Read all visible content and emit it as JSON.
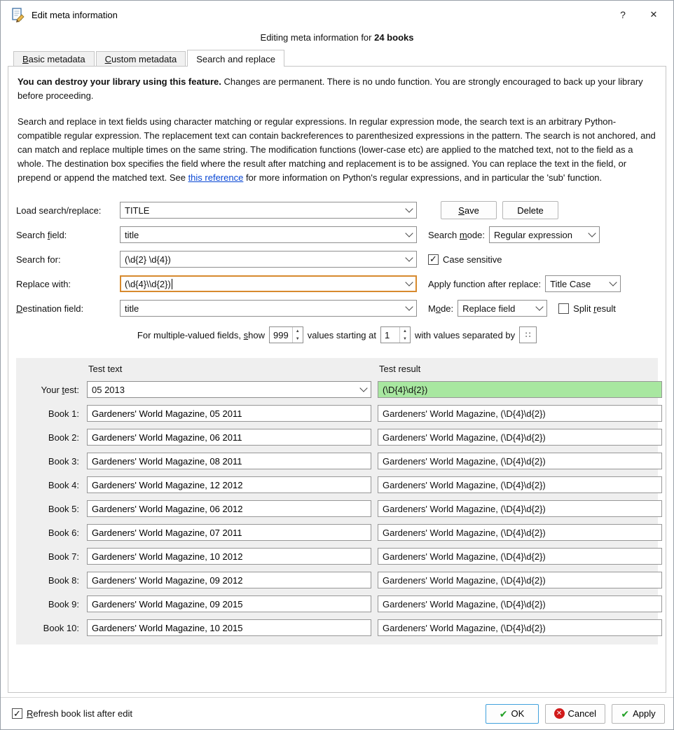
{
  "window": {
    "title": "Edit meta information",
    "help_label": "?",
    "close_label": "✕"
  },
  "header": {
    "caption_prefix": "Editing meta information for ",
    "caption_bold": "24 books"
  },
  "tabs": [
    {
      "label": "&Basic metadata"
    },
    {
      "label": "&Custom metadata"
    },
    {
      "label": "Search and replace"
    }
  ],
  "intro": {
    "warning_bold": "You can destroy your library using this feature.",
    "warning_rest": " Changes are permanent. There is no undo function. You are strongly encouraged to back up your library before proceeding.",
    "description_before_link": "Search and replace in text fields using character matching or regular expressions. In regular expression mode, the search text is an arbitrary Python-compatible regular expression. The replacement text can contain backreferences to parenthesized expressions in the pattern. The search is not anchored, and can match and replace multiple times on the same string. The modification functions (lower-case etc) are applied to the matched text, not to the field as a whole. The destination box specifies the field where the result after matching and replacement is to be assigned. You can replace the text in the field, or prepend or append the matched text. See ",
    "link_text": "this reference",
    "description_after_link": " for more information on Python's regular expressions, and in particular the 'sub' function."
  },
  "form": {
    "load_label": "Load search/replace:",
    "load_value": "TITLE",
    "save_button": "&Save",
    "delete_button": "Delete",
    "search_field_label": "Search &field:",
    "search_field_value": "title",
    "search_mode_label": "Search &mode:",
    "search_mode_value": "Regular expression",
    "search_for_label": "Search for:",
    "search_for_value": "(\\d{2} \\d{4})",
    "case_sensitive_label": "Case sensitive",
    "replace_with_label": "Replace with:",
    "replace_with_value": "(\\d{4}\\\\d{2})",
    "apply_function_label": "Apply function after replace:",
    "apply_function_value": "Title Case",
    "destination_label": "&Destination field:",
    "destination_value": "title",
    "mode_label": "M&ode:",
    "mode_value": "Replace field",
    "split_result_label": "Split &result",
    "multi_label_1": "For multiple-valued fields, &show",
    "multi_show_value": "999",
    "multi_label_2": "values starting at",
    "multi_start_value": "1",
    "multi_label_3": "with values separated by",
    "multi_separator": "∷"
  },
  "test": {
    "col_test_text": "Test text",
    "col_test_result": "Test result",
    "your_test_label": "Your &test:",
    "your_test_value": "05 2013",
    "your_test_result": "(\\D{4}\\d{2})",
    "books": [
      {
        "label": "Book 1:",
        "text": "Gardeners' World Magazine, 05 2011",
        "result": "Gardeners' World Magazine, (\\D{4}\\d{2})"
      },
      {
        "label": "Book 2:",
        "text": "Gardeners' World Magazine, 06 2011",
        "result": "Gardeners' World Magazine, (\\D{4}\\d{2})"
      },
      {
        "label": "Book 3:",
        "text": "Gardeners' World Magazine, 08 2011",
        "result": "Gardeners' World Magazine, (\\D{4}\\d{2})"
      },
      {
        "label": "Book 4:",
        "text": "Gardeners' World Magazine, 12 2012",
        "result": "Gardeners' World Magazine, (\\D{4}\\d{2})"
      },
      {
        "label": "Book 5:",
        "text": "Gardeners' World Magazine, 06 2012",
        "result": "Gardeners' World Magazine, (\\D{4}\\d{2})"
      },
      {
        "label": "Book 6:",
        "text": "Gardeners' World Magazine, 07 2011",
        "result": "Gardeners' World Magazine, (\\D{4}\\d{2})"
      },
      {
        "label": "Book 7:",
        "text": "Gardeners' World Magazine, 10 2012",
        "result": "Gardeners' World Magazine, (\\D{4}\\d{2})"
      },
      {
        "label": "Book 8:",
        "text": "Gardeners' World Magazine, 09 2012",
        "result": "Gardeners' World Magazine, (\\D{4}\\d{2})"
      },
      {
        "label": "Book 9:",
        "text": "Gardeners' World Magazine, 09 2015",
        "result": "Gardeners' World Magazine, (\\D{4}\\d{2})"
      },
      {
        "label": "Book 10:",
        "text": "Gardeners' World Magazine, 10 2015",
        "result": "Gardeners' World Magazine, (\\D{4}\\d{2})"
      }
    ]
  },
  "footer": {
    "refresh_label": "&Refresh book list after edit",
    "ok_label": "OK",
    "cancel_label": "Cancel",
    "apply_label": "Apply"
  },
  "colors": {
    "focus_border": "#d78a2e",
    "result_ok_bg": "#a8e7a0",
    "link": "#0846d4",
    "default_button_border": "#41a1dd",
    "check_green": "#23a127",
    "cancel_red": "#d11a1a"
  }
}
